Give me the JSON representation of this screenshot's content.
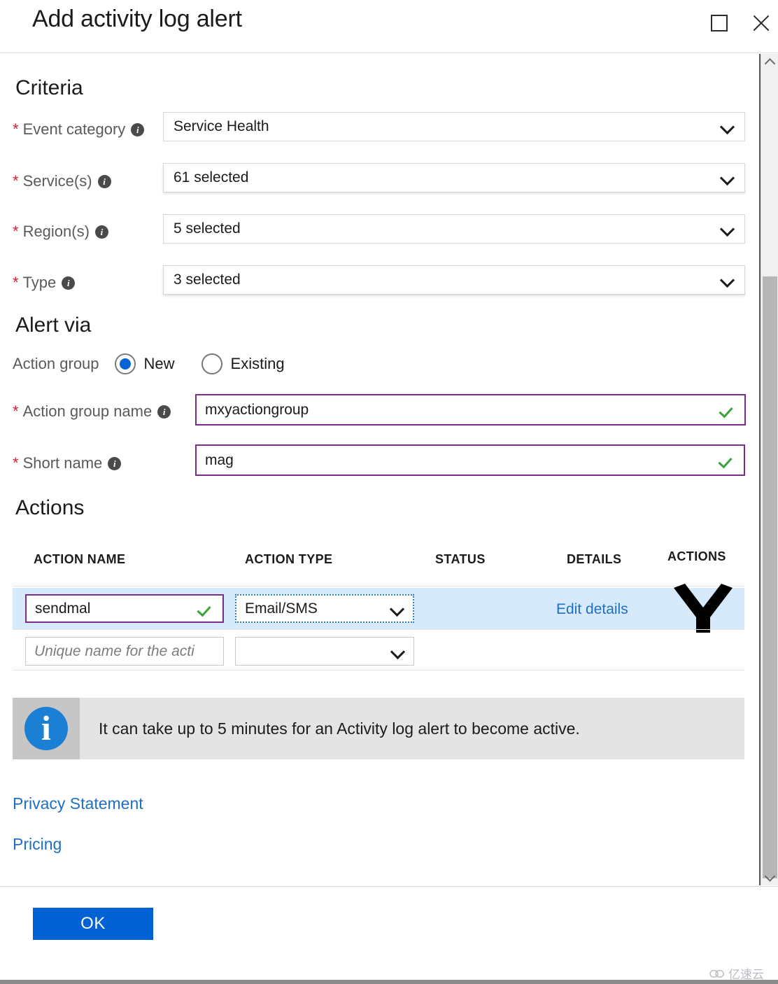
{
  "window": {
    "title": "Add activity log alert",
    "maximize_icon": "maximize-square-icon",
    "close_icon": "close-x-icon"
  },
  "criteria": {
    "heading": "Criteria",
    "fields": [
      {
        "label": "Event category",
        "required": "*",
        "info": "i",
        "value": "Service Health"
      },
      {
        "label": "Service(s)",
        "required": "*",
        "info": "i",
        "value": "61 selected"
      },
      {
        "label": "Region(s)",
        "required": "*",
        "info": "i",
        "value": "5 selected"
      },
      {
        "label": "Type",
        "required": "*",
        "info": "i",
        "value": "3 selected"
      }
    ]
  },
  "alert_via": {
    "heading": "Alert via",
    "action_group_label": "Action group",
    "options": [
      {
        "label": "New",
        "selected": true
      },
      {
        "label": "Existing",
        "selected": false
      }
    ],
    "action_group_name": {
      "label": "Action group name",
      "required": "*",
      "info": "i",
      "value": "mxyactiongroup",
      "valid": true
    },
    "short_name": {
      "label": "Short name",
      "required": "*",
      "info": "i",
      "value": "mag",
      "valid": true
    }
  },
  "actions": {
    "heading": "Actions",
    "columns": [
      "ACTION NAME",
      "ACTION TYPE",
      "STATUS",
      "DETAILS",
      "ACTIONS"
    ],
    "rows": [
      {
        "name": "sendmal",
        "name_valid": true,
        "type": "Email/SMS",
        "status": "",
        "details": "Edit details",
        "action_icon": "delete-chevron-icon",
        "highlighted": true
      },
      {
        "name_placeholder": "Unique name for the acti",
        "name": "",
        "type": "",
        "status": "",
        "details": "",
        "highlighted": false
      }
    ]
  },
  "banner": {
    "icon": "info-circle-icon",
    "text": "It can take up to 5 minutes for an Activity log alert to become active."
  },
  "links": [
    {
      "label": "Privacy Statement"
    },
    {
      "label": "Pricing"
    }
  ],
  "footer": {
    "ok_label": "OK"
  },
  "scrollbar": {
    "up_icon": "chevron-up-icon",
    "down_icon": "chevron-down-icon"
  },
  "watermark": {
    "text": "亿速云",
    "icon": "cloud-icon"
  },
  "colors": {
    "accent_blue": "#0062d4",
    "link_blue": "#1f6fc4",
    "validation_purple": "#7b2d8e",
    "valid_green": "#3aa33a",
    "required_red": "#cc2233",
    "row_highlight": "#d6eafb",
    "banner_bg": "#e4e4e4"
  }
}
